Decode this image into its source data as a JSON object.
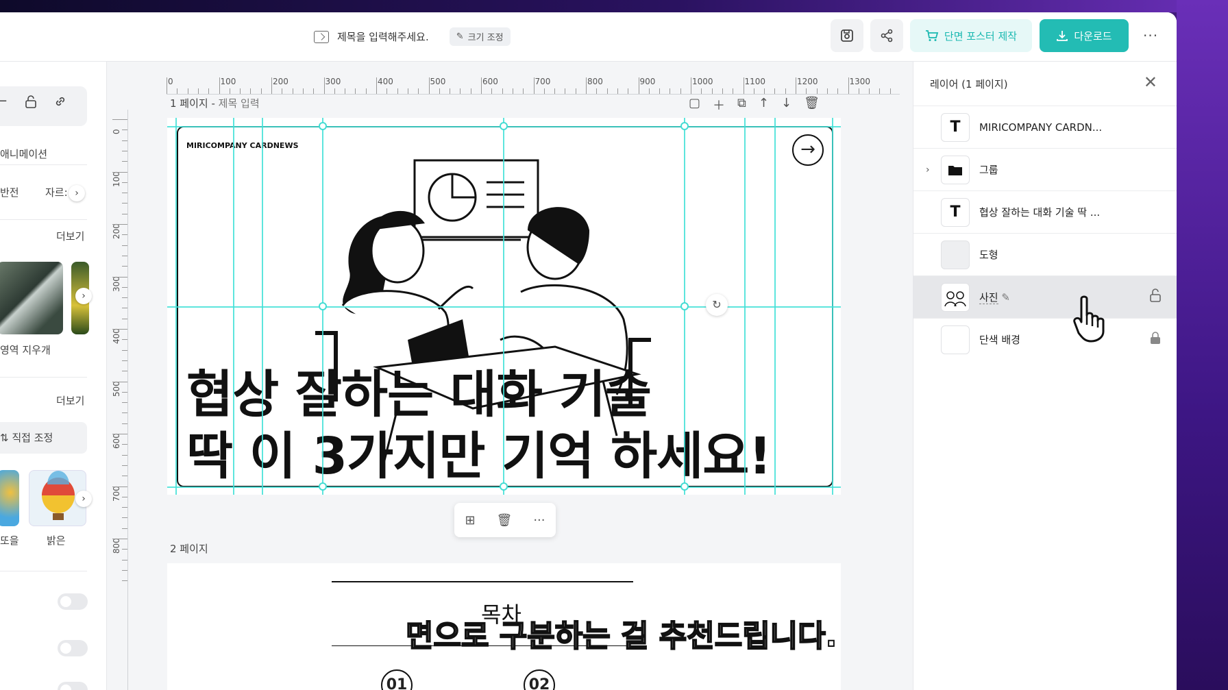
{
  "header": {
    "title_placeholder": "제목을 입력해주세요.",
    "resize_label": "크기 조정",
    "poster_label": "단면 포스터 제작",
    "download_label": "다운로드"
  },
  "left_panel": {
    "animation_label": "애니메이션",
    "flip_label": "반전",
    "crop_label": "자르:",
    "more_label_1": "더보기",
    "erase_area_label": "영역 지우개",
    "more_label_2": "더보기",
    "manual_adjust_label": "직접 조정",
    "filter_left_label": "또을",
    "filter_bright_label": "밝은"
  },
  "ruler": {
    "top_ticks": [
      "0",
      "100",
      "200",
      "300",
      "400",
      "500",
      "600",
      "700",
      "800",
      "900",
      "1000",
      "1100",
      "1200",
      "1300"
    ],
    "left_ticks": [
      "0",
      "100",
      "200",
      "300",
      "400",
      "500",
      "600",
      "700",
      "800"
    ]
  },
  "page1": {
    "label": "1 페이지 - ",
    "sub": "제목 입력",
    "brand": "MIRICOMPANY CARDNEWS",
    "headline_line1": "협상 잘하는 대화 기술",
    "headline_line2": "딱 이 3가지만 기억 하세요!"
  },
  "page2": {
    "label": "2 페이지",
    "toc": "목차",
    "subtitle": "면으로 구분하는 걸 추천드립니다.",
    "num1": "01",
    "num2": "02"
  },
  "layers": {
    "title": "레이어 (1 페이지)",
    "items": [
      {
        "label": "MIRICOMPANY CARDN...",
        "icon": "text-icon"
      },
      {
        "label": "그룹",
        "icon": "folder-icon"
      },
      {
        "label": "협상 잘하는 대화 기술 딱 ...",
        "icon": "text-icon"
      },
      {
        "label": "도형",
        "icon": "shape-icon"
      },
      {
        "label": "사진",
        "icon": "photo-icon"
      },
      {
        "label": "단색 배경",
        "icon": "background-icon"
      }
    ]
  }
}
